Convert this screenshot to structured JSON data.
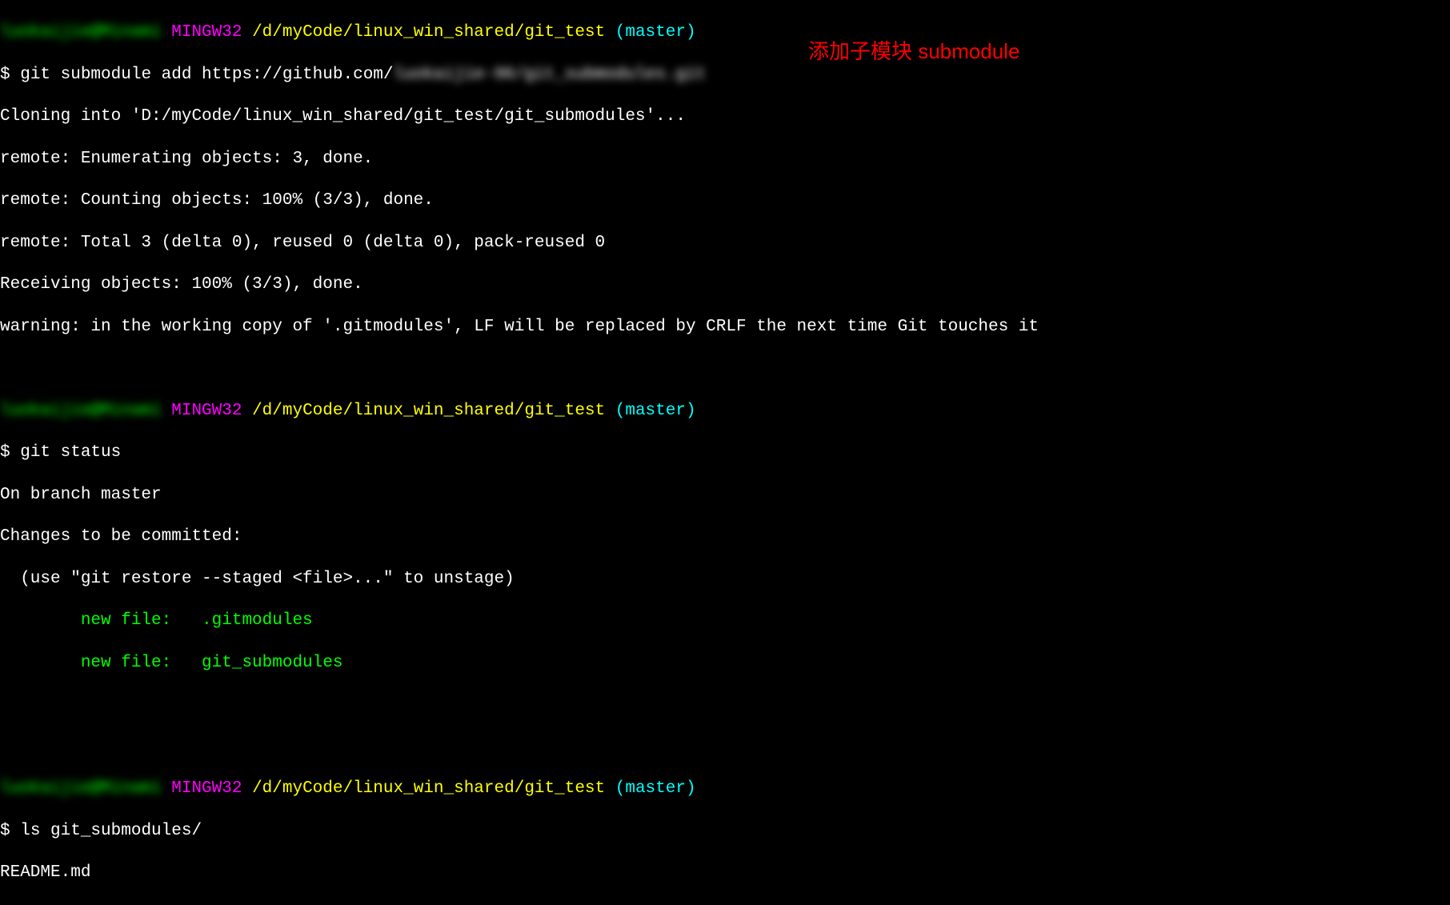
{
  "prompt1": {
    "user_host": "luokaijie@Minami",
    "shell": " MINGW32 ",
    "path": "/d/myCode/linux_win_shared/git_test ",
    "branch": "(master)",
    "dollar": "$ ",
    "cmd_prefix": "git submodule add https://github.com/",
    "cmd_blurred": "luokaijie-96/git_submodules.git"
  },
  "output1": {
    "line1a": "Cloning into 'D:/myCode/linux_win_shared/git_test/git_submodules'...",
    "line1b": "remote: Enumerating objects: 3, done.",
    "line1c": "remote: Counting objects: 100% (3/3), done.",
    "line1d": "remote: Total 3 (delta 0), reused 0 (delta 0), pack-reused 0",
    "line1e": "Receiving objects: 100% (3/3), done.",
    "line1f": "warning: in the working copy of '.gitmodules', LF will be replaced by CRLF the next time Git touches it"
  },
  "prompt2": {
    "user_host": "luokaijie@Minami",
    "shell": " MINGW32 ",
    "path": "/d/myCode/linux_win_shared/git_test ",
    "branch": "(master)",
    "dollar": "$ ",
    "cmd": "git status"
  },
  "output2": {
    "line2a": "On branch master",
    "line2b": "Changes to be committed:",
    "line2c": "  (use \"git restore --staged <file>...\" to unstage)",
    "line2d": "        new file:   .gitmodules",
    "line2e": "        new file:   git_submodules"
  },
  "prompt3": {
    "user_host": "luokaijie@Minami",
    "shell": " MINGW32 ",
    "path": "/d/myCode/linux_win_shared/git_test ",
    "branch": "(master)",
    "dollar": "$ ",
    "cmd": "ls git_submodules/"
  },
  "output3": {
    "line3a": "README.md"
  },
  "annotation": "添加子模块 submodule"
}
